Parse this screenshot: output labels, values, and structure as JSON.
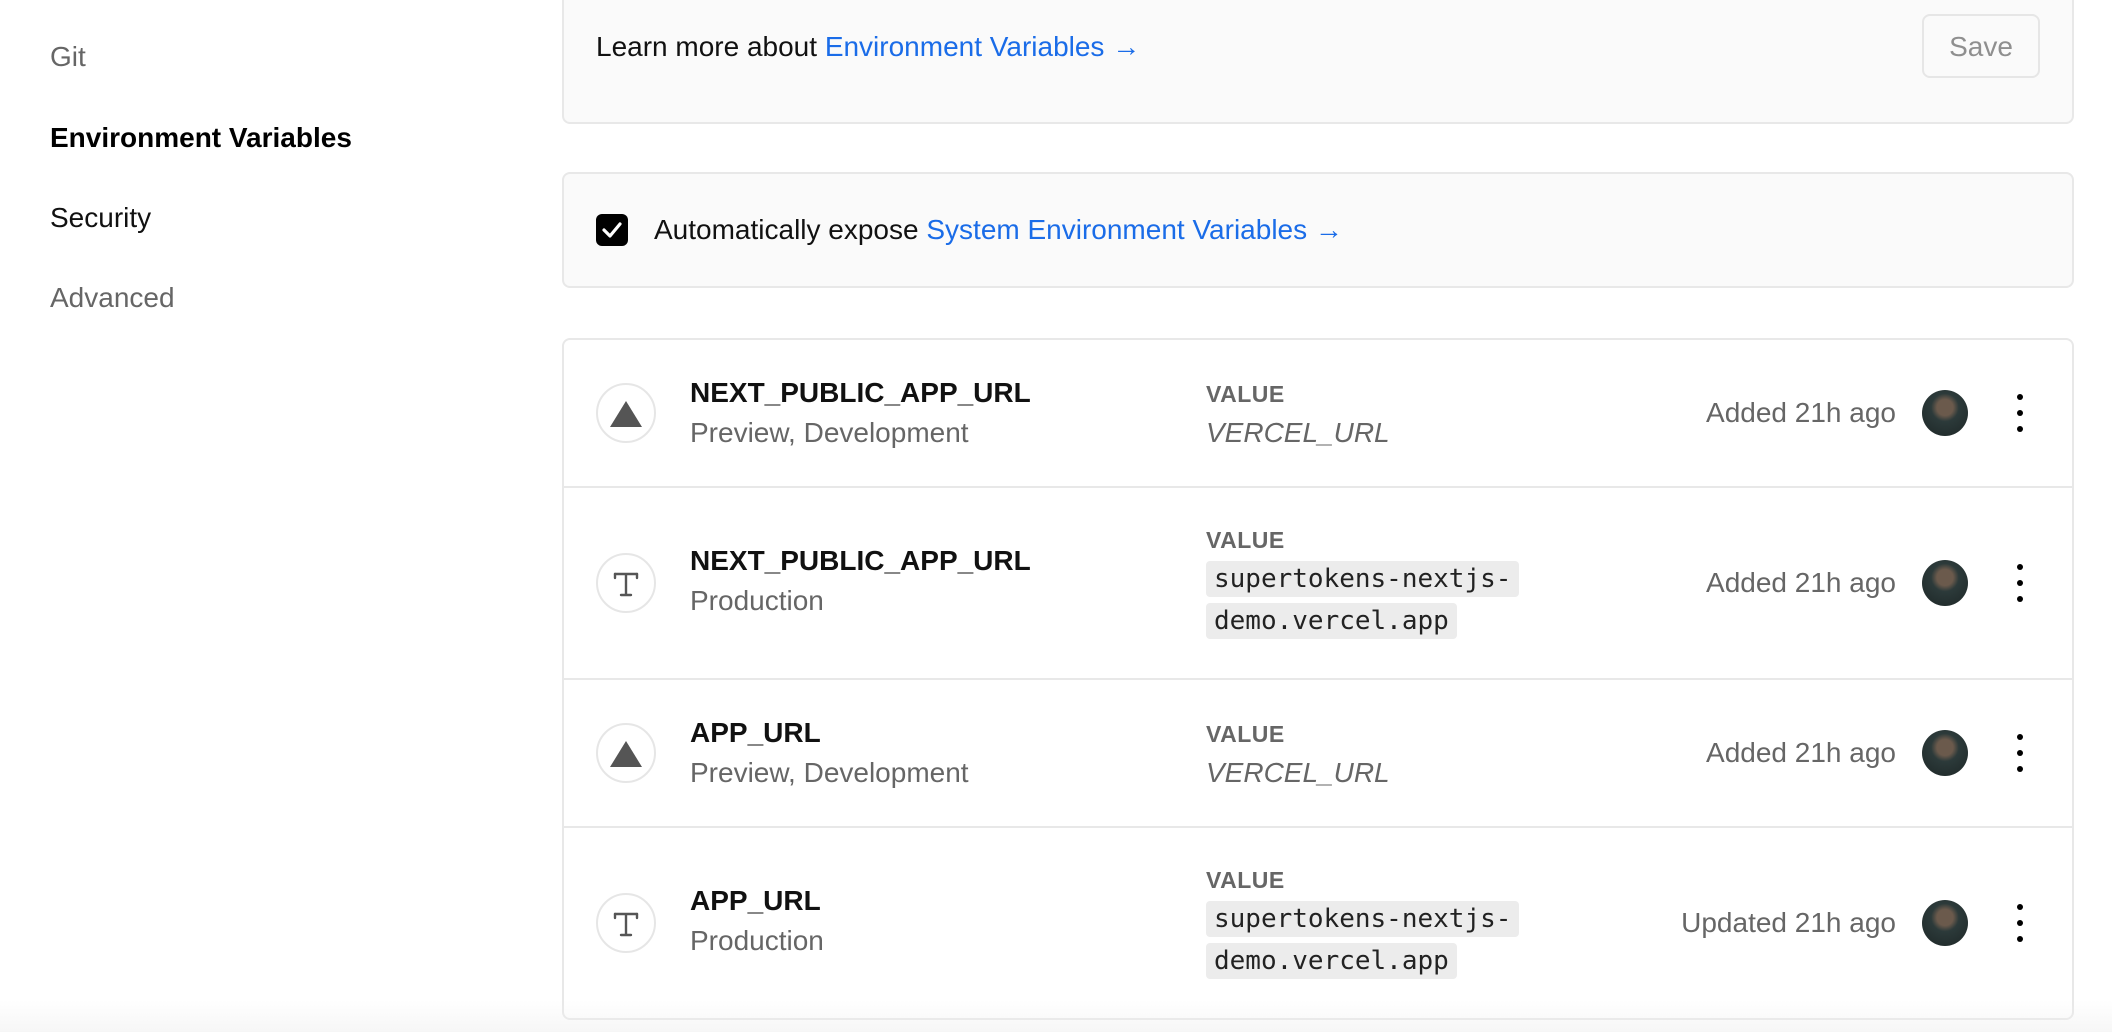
{
  "sidebar": {
    "items": [
      {
        "label": "Git"
      },
      {
        "label": "Environment Variables"
      },
      {
        "label": "Security"
      },
      {
        "label": "Advanced"
      }
    ]
  },
  "learn": {
    "prefix": "Learn more about ",
    "link": "Environment Variables →",
    "save_label": "Save"
  },
  "expose": {
    "checked": true,
    "prefix": "Automatically expose ",
    "link": "System Environment Variables →"
  },
  "env_vars": [
    {
      "icon": "vercel-triangle-icon",
      "name": "NEXT_PUBLIC_APP_URL",
      "environments": "Preview, Development",
      "value_label": "VALUE",
      "value": "VERCEL_URL",
      "added": "Added 21h ago"
    },
    {
      "icon": "text-t-icon",
      "name": "NEXT_PUBLIC_APP_URL",
      "environments": "Production",
      "value_label": "VALUE",
      "value": "supertokens-nextjs-demo.vercel.app",
      "added": "Added 21h ago"
    },
    {
      "icon": "vercel-triangle-icon",
      "name": "APP_URL",
      "environments": "Preview, Development",
      "value_label": "VALUE",
      "value": "VERCEL_URL",
      "added": "Added 21h ago"
    },
    {
      "icon": "text-t-icon",
      "name": "APP_URL",
      "environments": "Production",
      "value_label": "VALUE",
      "value": "supertokens-nextjs-demo.vercel.app",
      "added": "Updated 21h ago"
    }
  ],
  "colors": {
    "link": "#1a6ce8",
    "checkbox": "#000000",
    "card_background": "#fafafa",
    "border": "#e8e8e8"
  }
}
